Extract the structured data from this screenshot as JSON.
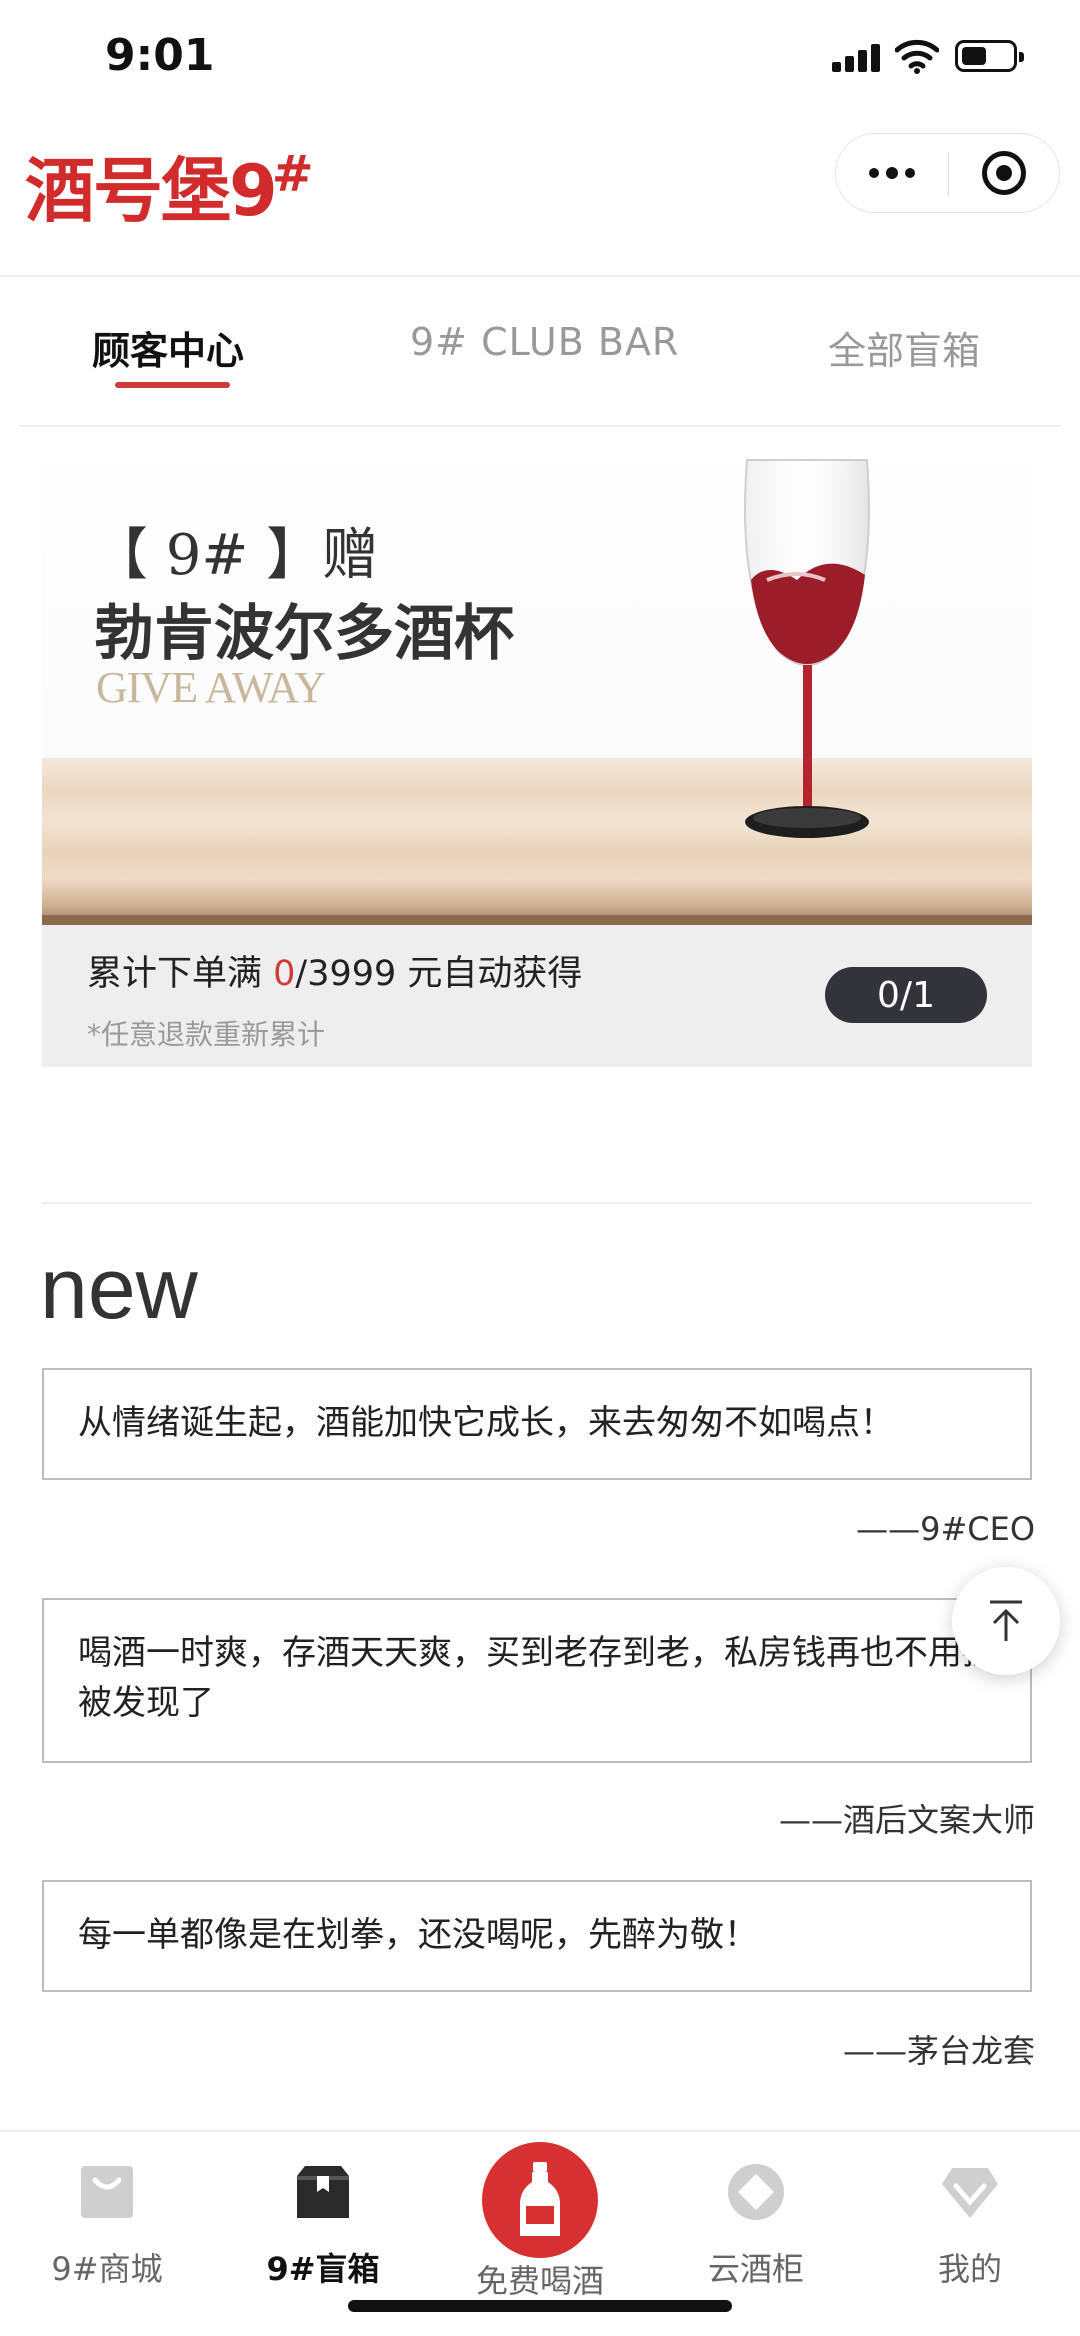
{
  "status_bar": {
    "time": "9:01"
  },
  "header": {
    "logo_text": "酒号堡9",
    "logo_hash": "#"
  },
  "tabs": [
    {
      "label": "顾客中心",
      "active": true
    },
    {
      "label": "9# CLUB BAR",
      "active": false
    },
    {
      "label": "全部盲箱",
      "active": false
    }
  ],
  "promo": {
    "line1": "【 9# 】赠",
    "line2": "勃肯波尔多酒杯",
    "line3": "GIVE AWAY",
    "progress_prefix": "累计下单满 ",
    "progress_current": "0",
    "progress_suffix": "/3999 元自动获得",
    "note": "*任意退款重新累计",
    "count_badge": "0/1"
  },
  "new_section": {
    "title": "new",
    "quotes": [
      {
        "text": "从情绪诞生起，酒能加快它成长，来去匆匆不如喝点！",
        "author": "——9#CEO"
      },
      {
        "text": "喝酒一时爽，存酒天天爽，买到老存到老，私房钱再也不用担心被发现了",
        "author": "——酒后文案大师"
      },
      {
        "text": "每一单都像是在划拳，还没喝呢，先醉为敬！",
        "author": "——茅台龙套"
      }
    ]
  },
  "tab_bar": [
    {
      "label": "9#商城",
      "icon": "shop-bag-icon",
      "active": false
    },
    {
      "label": "9#盲箱",
      "icon": "blind-box-icon",
      "active": true
    },
    {
      "label": "免费喝酒",
      "icon": "bottle-icon",
      "active": false
    },
    {
      "label": "云酒柜",
      "icon": "cloud-cabinet-icon",
      "active": false
    },
    {
      "label": "我的",
      "icon": "diamond-icon",
      "active": false
    }
  ],
  "colors": {
    "brand_red": "#d12b2b",
    "accent_red": "#d23a3a",
    "badge_dark": "#33333b"
  }
}
